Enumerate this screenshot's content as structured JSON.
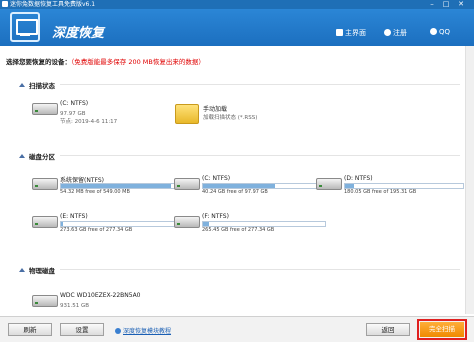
{
  "window": {
    "title": "迷你兔数据恢复工具免费版v6.1",
    "controls": {
      "minimize": "–",
      "maximize": "□",
      "close": "✕"
    }
  },
  "header": {
    "brand": "深度恢复",
    "nav": {
      "home": "主界面",
      "register": "注册",
      "qq": "QQ"
    }
  },
  "prompt": {
    "text": "选择您要恢复的设备：",
    "notice": "（免费版能最多保存 200 MB恢复出来的数据）"
  },
  "sections": {
    "scan_state": {
      "title": "扫描状态",
      "items": [
        {
          "name": "(C: NTFS)",
          "size": "97.97 GB",
          "time": "节点: 2019-4-6 11:17"
        },
        {
          "name": "手动加载",
          "detail": "加载扫描状态 (*.RSS)"
        }
      ]
    },
    "partitions": {
      "title": "磁盘分区",
      "items": [
        {
          "name": "系统保留(NTFS)",
          "usage": "54.32 MB free of 549.00 MB",
          "fill": 0.9
        },
        {
          "name": "(C: NTFS)",
          "usage": "40.24 GB free of 97.97 GB",
          "fill": 0.59
        },
        {
          "name": "(D: NTFS)",
          "usage": "180.05 GB free of 195.31 GB",
          "fill": 0.08
        },
        {
          "name": "(E: NTFS)",
          "usage": "273.63 GB free of 277.34 GB",
          "fill": 0.02
        },
        {
          "name": "(F: NTFS)",
          "usage": "265.45 GB free of 277.34 GB",
          "fill": 0.05
        }
      ]
    },
    "physical": {
      "title": "物理磁盘",
      "items": [
        {
          "name": "WDC WD10EZEX-22BN5A0",
          "size": "931.51 GB"
        }
      ]
    }
  },
  "footer": {
    "refresh": "刷新",
    "settings": "设置",
    "tutorial": "深度恢复模块教程",
    "back": "返回",
    "full_scan": "完全扫描"
  },
  "colors": {
    "brand_blue": "#1f6fb6",
    "accent_orange": "#f08a00",
    "notice_red": "#e00000",
    "highlight_red": "#e02020"
  }
}
